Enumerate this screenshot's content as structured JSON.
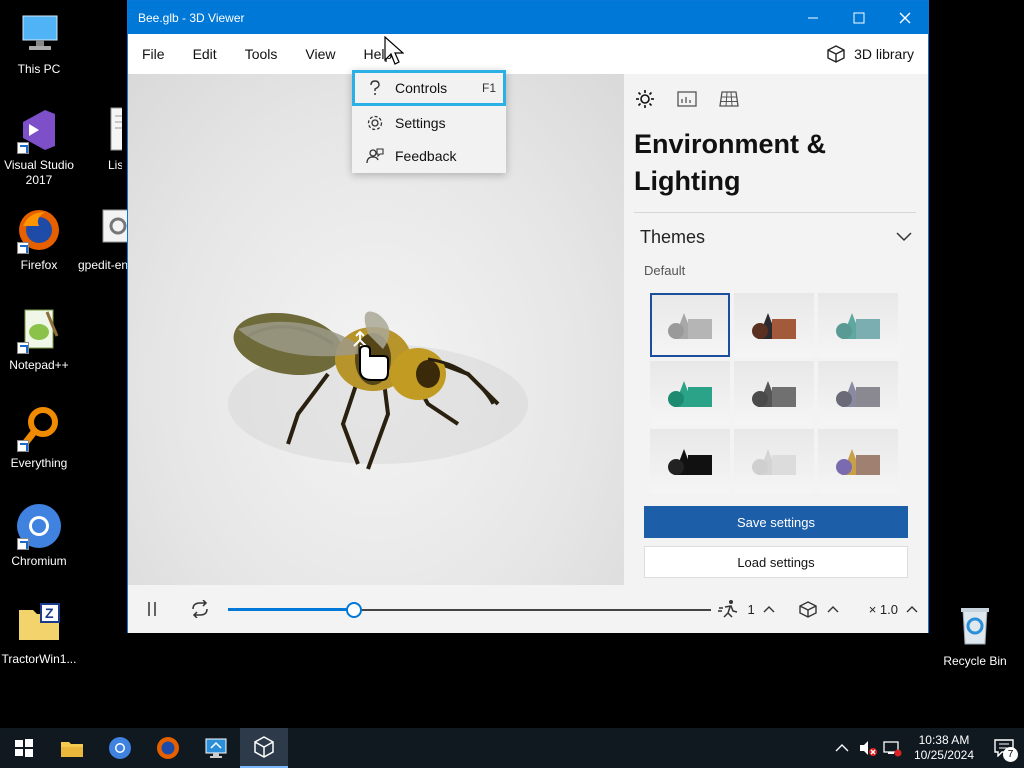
{
  "window": {
    "title": "Bee.glb - 3D Viewer",
    "menu": [
      "File",
      "Edit",
      "Tools",
      "View",
      "Help"
    ],
    "library_label": "3D library"
  },
  "help_menu": {
    "items": [
      {
        "label": "Controls",
        "accel": "F1",
        "icon": "question-icon"
      },
      {
        "label": "Settings",
        "accel": "",
        "icon": "gear-icon"
      },
      {
        "label": "Feedback",
        "accel": "",
        "icon": "feedback-icon"
      }
    ],
    "highlight_color": "#2bb0e6"
  },
  "panel": {
    "title_line1": "Environment &",
    "title_line2": "Lighting",
    "themes_label": "Themes",
    "default_label": "Default",
    "save_label": "Save settings",
    "load_label": "Load settings",
    "save_color": "#1c5ea8",
    "selected_theme_index": 0
  },
  "playbar": {
    "progress": 0.26,
    "speed_value": "1",
    "zoom_value": "× 1.0"
  },
  "desktop": {
    "icons": [
      "This PC",
      "Visual Studio 2017",
      "List",
      "Firefox",
      "gpedit-en",
      "Notepad++",
      "Everything",
      "Chromium",
      "TractorWin1...",
      "Recycle Bin"
    ]
  },
  "taskbar": {
    "time": "10:38 AM",
    "date": "10/25/2024",
    "notification_count": "7"
  },
  "accent_color": "#0078d7"
}
